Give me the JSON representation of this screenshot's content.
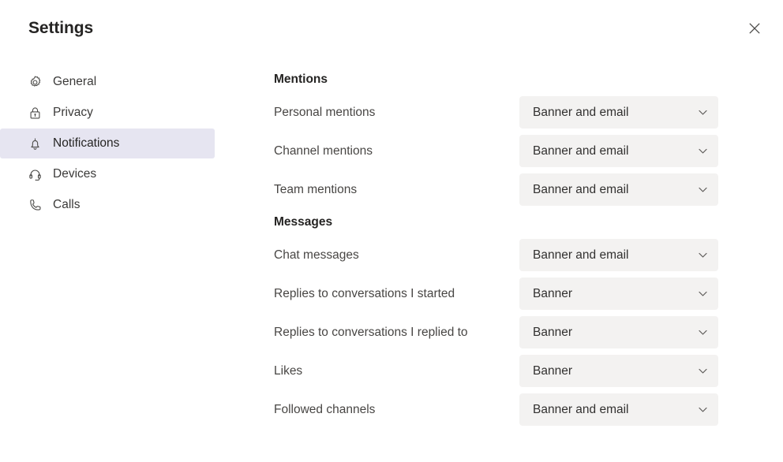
{
  "dialog": {
    "title": "Settings",
    "close_icon": "close-icon"
  },
  "sidebar": {
    "items": [
      {
        "label": "General",
        "icon": "gear-icon",
        "selected": false
      },
      {
        "label": "Privacy",
        "icon": "lock-icon",
        "selected": false
      },
      {
        "label": "Notifications",
        "icon": "bell-icon",
        "selected": true
      },
      {
        "label": "Devices",
        "icon": "headset-icon",
        "selected": false
      },
      {
        "label": "Calls",
        "icon": "phone-icon",
        "selected": false
      }
    ]
  },
  "content": {
    "sections": [
      {
        "heading": "Mentions",
        "rows": [
          {
            "label": "Personal mentions",
            "value": "Banner and email"
          },
          {
            "label": "Channel mentions",
            "value": "Banner and email"
          },
          {
            "label": "Team mentions",
            "value": "Banner and email"
          }
        ]
      },
      {
        "heading": "Messages",
        "rows": [
          {
            "label": "Chat messages",
            "value": "Banner and email"
          },
          {
            "label": "Replies to conversations I started",
            "value": "Banner"
          },
          {
            "label": "Replies to conversations I replied to",
            "value": "Banner"
          },
          {
            "label": "Likes",
            "value": "Banner"
          },
          {
            "label": "Followed channels",
            "value": "Banner and email"
          }
        ]
      }
    ]
  },
  "colors": {
    "selected_nav_background": "#e6e5f1",
    "dropdown_background": "#f3f2f1",
    "text_primary": "#252423",
    "text_secondary": "#484644",
    "page_background": "#ffffff"
  }
}
